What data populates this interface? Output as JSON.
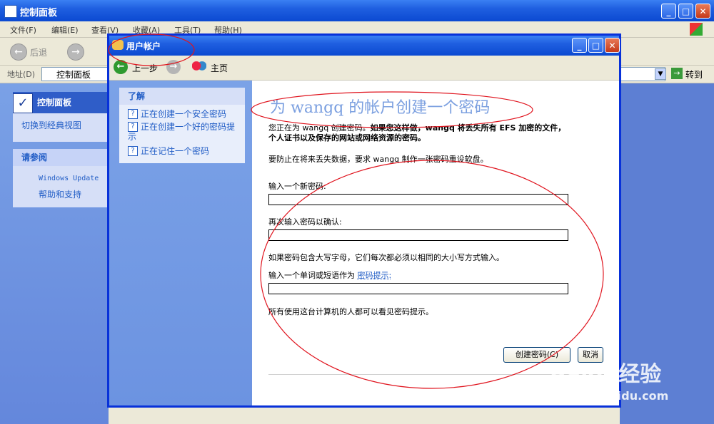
{
  "back_window": {
    "title": "控制面板",
    "menu": [
      "文件(F)",
      "编辑(E)",
      "查看(V)",
      "收藏(A)",
      "工具(T)",
      "帮助(H)"
    ],
    "back_label": "后退",
    "address_label": "地址(D)",
    "address_value": "控制面板",
    "go_label": "转到",
    "left_panel": {
      "title": "控制面板",
      "switch_view": "切换到经典视图",
      "see_also_title": "请参阅",
      "see_also_items": [
        "Windows Update",
        "帮助和支持"
      ]
    }
  },
  "dialog": {
    "title": "用户帐户",
    "back_label": "上一步",
    "home_label": "主页",
    "side": {
      "header": "了解",
      "links": [
        "正在创建一个安全密码",
        "正在创建一个好的密码提示",
        "正在记住一个密码"
      ]
    },
    "main": {
      "heading": "为 wangq 的帐户创建一个密码",
      "intro_prefix": "您正在为 wangq 创建密码。",
      "intro_bold": "如果您这样做，wangq 将丢失所有 EFS 加密的文件，个人证书以及保存的网站或网络资源的密码。",
      "reset_disk": "要防止在将来丢失数据，要求 wangq 制作一张密码重设软盘。",
      "new_password_label": "输入一个新密码:",
      "confirm_password_label": "再次输入密码以确认:",
      "case_note": "如果密码包含大写字母，它们每次都必须以相同的大小写方式输入。",
      "hint_label_prefix": "输入一个单词或短语作为",
      "hint_link": "密码提示:",
      "hint_note": "所有使用这台计算机的人都可以看见密码提示。",
      "create_button": "创建密码(C)",
      "cancel_button": "取消"
    }
  },
  "watermark": {
    "text": "Baidu经验",
    "sub": "jingyan.baidu.com"
  },
  "colors": {
    "title_blue": "#0b49d1",
    "link_blue": "#215dc6",
    "heading_blue": "#7ca0e0",
    "annotation_red": "#e0141e"
  }
}
